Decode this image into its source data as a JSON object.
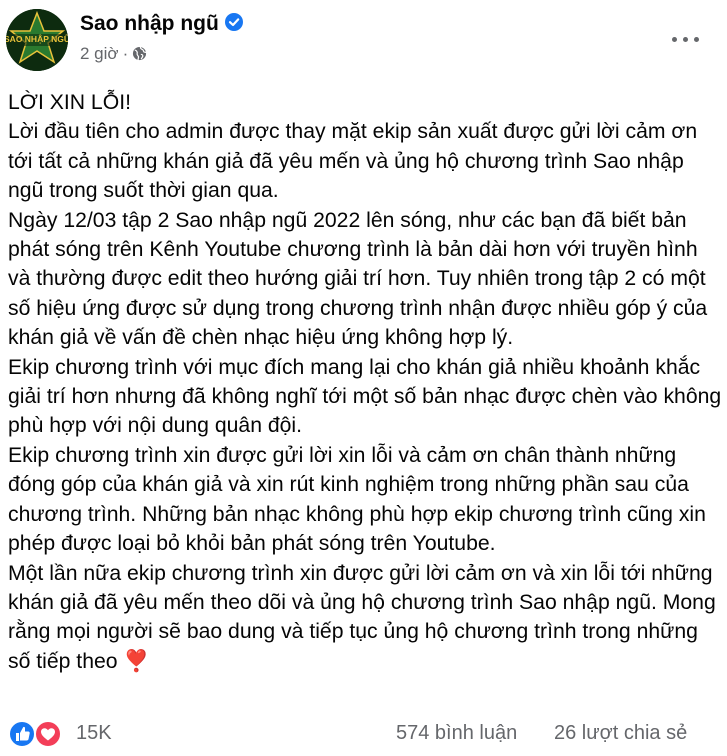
{
  "post": {
    "page_name": "Sao nhập ngũ",
    "timestamp": "2 giờ",
    "separator": "·",
    "avatar_text": "SAO NHẬP NGŨ",
    "paragraphs": [
      "LỜI XIN LỖI!",
      "Lời đầu tiên cho admin được thay mặt ekip sản xuất được gửi lời cảm ơn tới tất cả những khán giả đã yêu mến và ủng hộ chương trình Sao nhập ngũ trong suốt thời gian qua.",
      "Ngày 12/03 tập 2 Sao nhập ngũ 2022 lên sóng, như các bạn đã biết bản phát sóng trên Kênh Youtube chương trình là bản dài hơn với truyền hình và thường được edit theo hướng giải trí hơn. Tuy nhiên trong tập 2 có một số hiệu ứng được sử dụng trong chương trình nhận được nhiều góp ý của khán giả về vấn đề chèn nhạc hiệu ứng không hợp lý.",
      "Ekip chương trình với mục đích mang lại cho khán giả nhiều khoảnh khắc giải trí hơn nhưng đã không nghĩ tới một số bản nhạc được chèn vào không phù hợp với nội dung quân đội.",
      "Ekip chương trình xin được gửi lời xin lỗi và cảm ơn chân thành những đóng góp của khán giả và xin rút kinh nghiệm trong những phần sau của chương trình. Những bản nhạc không phù hợp ekip chương trình cũng xin phép được loại bỏ khỏi bản phát sóng trên Youtube.",
      "Một lần nữa ekip chương trình xin được gửi lời cảm ơn và xin lỗi tới những khán giả đã yêu mến theo dõi và ủng hộ chương trình Sao nhập ngũ. Mong rằng mọi người sẽ bao dung và tiếp tục ủng hộ chương trình trong những số tiếp theo ❣️"
    ]
  },
  "footer": {
    "reaction_count": "15K",
    "comments": "574 bình luận",
    "shares": "26 lượt chia sẻ"
  },
  "icons": {
    "verified": "verified-badge-icon",
    "privacy": "globe-icon",
    "more": "more-options-icon",
    "like": "like-reaction-icon",
    "love": "love-reaction-icon"
  },
  "colors": {
    "facebook_blue": "#1877f2",
    "love_red": "#f33e58",
    "secondary_text": "#65676b",
    "avatar_gold": "#e8c23a"
  }
}
